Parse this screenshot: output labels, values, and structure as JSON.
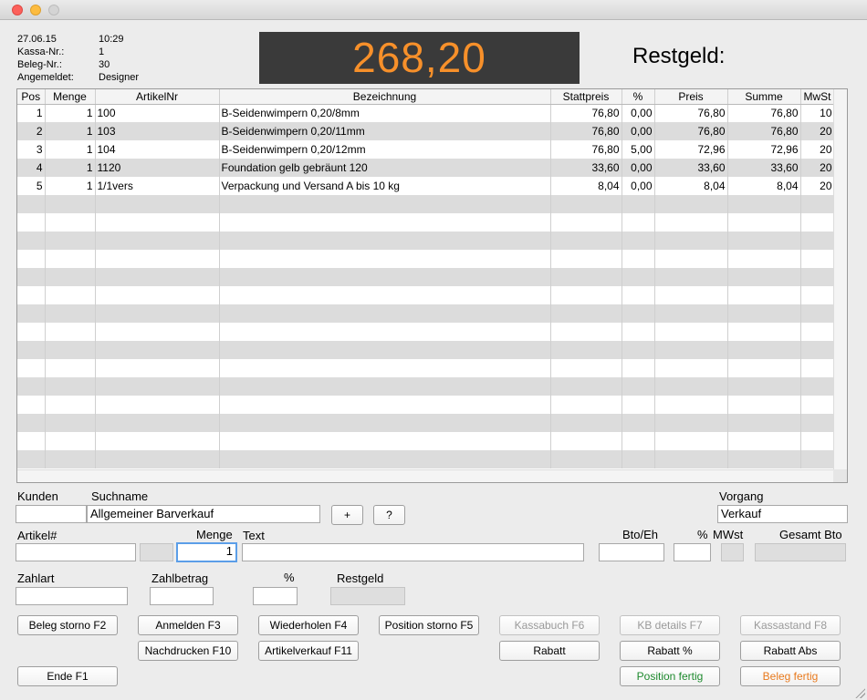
{
  "info": {
    "date": "27.06.15",
    "time": "10:29",
    "kassa_label": "Kassa-Nr.:",
    "kassa_value": "1",
    "beleg_label": "Beleg-Nr.:",
    "beleg_value": "30",
    "user_label": "Angemeldet:",
    "user_value": "Designer"
  },
  "display": {
    "total": "268,20",
    "restgeld_label": "Restgeld:"
  },
  "table": {
    "columns": [
      "Pos",
      "Menge",
      "ArtikelNr",
      "Bezeichnung",
      "Stattpreis",
      "%",
      "Preis",
      "Summe",
      "MwSt"
    ],
    "rows": [
      [
        "1",
        "1",
        "100",
        "B-Seidenwimpern 0,20/8mm",
        "76,80",
        "0,00",
        "76,80",
        "76,80",
        "10"
      ],
      [
        "2",
        "1",
        "103",
        "B-Seidenwimpern 0,20/11mm",
        "76,80",
        "0,00",
        "76,80",
        "76,80",
        "20"
      ],
      [
        "3",
        "1",
        "104",
        "B-Seidenwimpern 0,20/12mm",
        "76,80",
        "5,00",
        "72,96",
        "72,96",
        "20"
      ],
      [
        "4",
        "1",
        "1120",
        "Foundation gelb gebräunt 120",
        "33,60",
        "0,00",
        "33,60",
        "33,60",
        "20"
      ],
      [
        "5",
        "1",
        "1/1vers",
        "Verpackung und Versand A bis 10 kg",
        "8,04",
        "0,00",
        "8,04",
        "8,04",
        "20"
      ]
    ]
  },
  "form": {
    "kunden_label": "Kunden",
    "suchname_label": "Suchname",
    "suchname_value": "Allgemeiner Barverkauf",
    "plus_label": "+",
    "question_label": "?",
    "vorgang_label": "Vorgang",
    "vorgang_value": "Verkauf",
    "artikel_label": "Artikel#",
    "menge_label": "Menge",
    "menge_value": "1",
    "text_label": "Text",
    "bto_label": "Bto/Eh",
    "percent_label": "%",
    "mwst_label": "MWst",
    "gesamt_label": "Gesamt Bto",
    "zahlart_label": "Zahlart",
    "zahlbetrag_label": "Zahlbetrag",
    "pct2_label": "%",
    "restgeld_label": "Restgeld"
  },
  "buttons": {
    "beleg_storno": "Beleg storno F2",
    "anmelden": "Anmelden F3",
    "wiederholen": "Wiederholen F4",
    "position_storno": "Position storno F5",
    "kassabuch": "Kassabuch F6",
    "kb_details": "KB details F7",
    "kassastand": "Kassastand F8",
    "nachdrucken": "Nachdrucken F10",
    "artikelverkauf": "Artikelverkauf F11",
    "rabatt": "Rabatt",
    "rabatt_pct": "Rabatt %",
    "rabatt_abs": "Rabatt Abs",
    "ende": "Ende F1",
    "position_fertig": "Position fertig",
    "beleg_fertig": "Beleg fertig"
  },
  "colors": {
    "display_bg": "#3a3a3a",
    "display_text": "#f7902a",
    "green": "#1e8a2e",
    "orange": "#e87a1e"
  }
}
